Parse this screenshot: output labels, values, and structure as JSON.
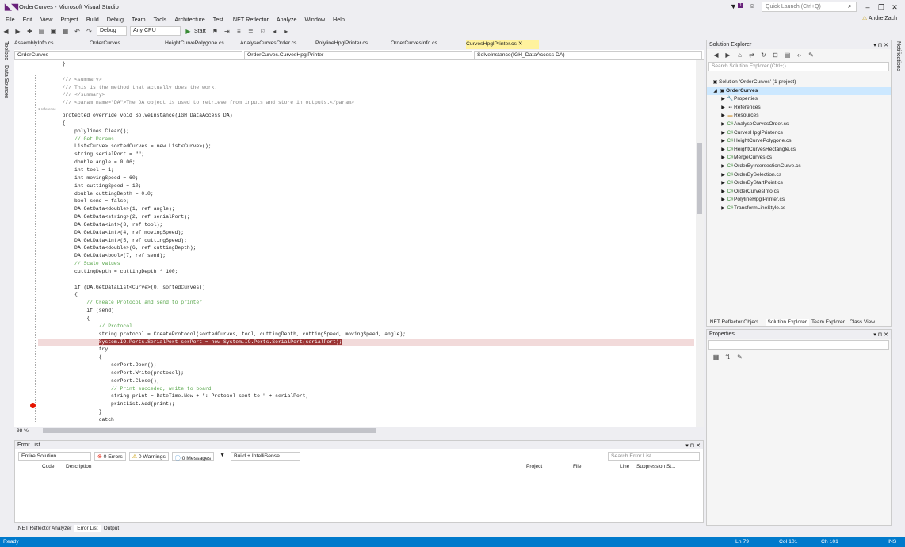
{
  "window": {
    "title": "OrderCurves - Microsoft Visual Studio",
    "quick_launch": "Quick Launch (Ctrl+Q)",
    "notification_count": "1",
    "user": "Andre Zach"
  },
  "menu": [
    "File",
    "Edit",
    "View",
    "Project",
    "Build",
    "Debug",
    "Team",
    "Tools",
    "Architecture",
    "Test",
    ".NET Reflector",
    "Analyze",
    "Window",
    "Help"
  ],
  "toolbar": {
    "config": "Debug",
    "platform": "Any CPU",
    "start": "Start"
  },
  "left_side": [
    "Toolbox",
    "Data Sources"
  ],
  "right_side": "Notifications",
  "doc_tabs": [
    {
      "label": "AssemblyInfo.cs",
      "active": false
    },
    {
      "label": "OrderCurves",
      "active": false
    },
    {
      "label": "HeightCurvePolygone.cs",
      "active": false
    },
    {
      "label": "AnalyseCurvesOrder.cs",
      "active": false
    },
    {
      "label": "PolylineHpglPrinter.cs",
      "active": false
    },
    {
      "label": "OrderCurvesInfo.cs",
      "active": false
    },
    {
      "label": "CurvesHpglPrinter.cs",
      "active": true
    }
  ],
  "nav": {
    "project": "OrderCurves",
    "class": "OrderCurves.CurvesHpglPrinter",
    "member": "SolveInstance(IGH_DataAccess DA)"
  },
  "code_lines": [
    "        }",
    "",
    "        /// <summary>",
    "        /// This is the method that actually does the work.",
    "        /// </summary>",
    "        /// <param name=\"DA\">The DA object is used to retrieve from inputs and store in outputs.</param>",
    "        protected override void SolveInstance(IGH_DataAccess DA)",
    "        {",
    "            polylines.Clear();",
    "            // Get Params",
    "            List<Curve> sortedCurves = new List<Curve>();",
    "            string serialPort = \"\";",
    "            double angle = 0.06;",
    "            int tool = 1;",
    "            int movingSpeed = 60;",
    "            int cuttingSpeed = 10;",
    "            double cuttingDepth = 0.0;",
    "            bool send = false;",
    "            DA.GetData<double>(1, ref angle);",
    "            DA.GetData<string>(2, ref serialPort);",
    "            DA.GetData<int>(3, ref tool);",
    "            DA.GetData<int>(4, ref movingSpeed);",
    "            DA.GetData<int>(5, ref cuttingSpeed);",
    "            DA.GetData<double>(6, ref cuttingDepth);",
    "            DA.GetData<bool>(7, ref send);",
    "            // Scale values",
    "            cuttingDepth = cuttingDepth * 100;",
    "",
    "            if (DA.GetDataList<Curve>(0, sortedCurves))",
    "            {",
    "                // Create Protocol and send to printer",
    "                if (send)",
    "                {",
    "                    // Protocol",
    "                    string protocol = CreateProtocol(sortedCurves, tool, cuttingDepth, cuttingSpeed, movingSpeed, angle);",
    "                    System.IO.Ports.SerialPort serPort = new System.IO.Ports.SerialPort(serialPort);",
    "                    try",
    "                    {",
    "                        serPort.Open();",
    "                        serPort.Write(protocol);",
    "                        serPort.Close();",
    "                        // Print succeded, write to board",
    "                        string print = DateTime.Now + \": Protocol sent to \" + serialPort;",
    "                        printList.Add(print);",
    "                    }",
    "                    catch"
  ],
  "references_label": "1 reference",
  "zoom": "98 %",
  "error_list": {
    "title": "Error List",
    "scope": "Entire Solution",
    "errors": "0 Errors",
    "warnings": "0 Warnings",
    "messages": "0 Messages",
    "build": "Build + IntelliSense",
    "search": "Search Error List",
    "columns": [
      "Code",
      "Description",
      "Project",
      "File",
      "Line",
      "Suppression St..."
    ]
  },
  "bottom_tabs": [
    {
      "label": ".NET Reflector Analyzer",
      "active": false
    },
    {
      "label": "Error List",
      "active": true
    },
    {
      "label": "Output",
      "active": false
    }
  ],
  "status": {
    "left": "Ready",
    "ln": "Ln 79",
    "col": "Col 101",
    "ch": "Ch 101",
    "ins": "INS"
  },
  "solution_explorer": {
    "title": "Solution Explorer",
    "search": "Search Solution Explorer (Ctrl+;)",
    "solution": "Solution 'OrderCurves' (1 project)",
    "project": "OrderCurves",
    "items": [
      "Properties",
      "References",
      "Resources",
      "AnalyseCurvesOrder.cs",
      "CurvesHpglPrinter.cs",
      "HeightCurvePolygone.cs",
      "HeightCurvesRectangle.cs",
      "MergeCurves.cs",
      "OrderByIntersectionCurve.cs",
      "OrderBySelection.cs",
      "OrderByStartPoint.cs",
      "OrderCurvesInfo.cs",
      "PolylineHpglPrinter.cs",
      "TransformLineStyle.cs"
    ],
    "tabs": [
      {
        "label": ".NET Reflector Object...",
        "active": false
      },
      {
        "label": "Solution Explorer",
        "active": true
      },
      {
        "label": "Team Explorer",
        "active": false
      },
      {
        "label": "Class View",
        "active": false
      }
    ]
  },
  "properties": {
    "title": "Properties"
  }
}
